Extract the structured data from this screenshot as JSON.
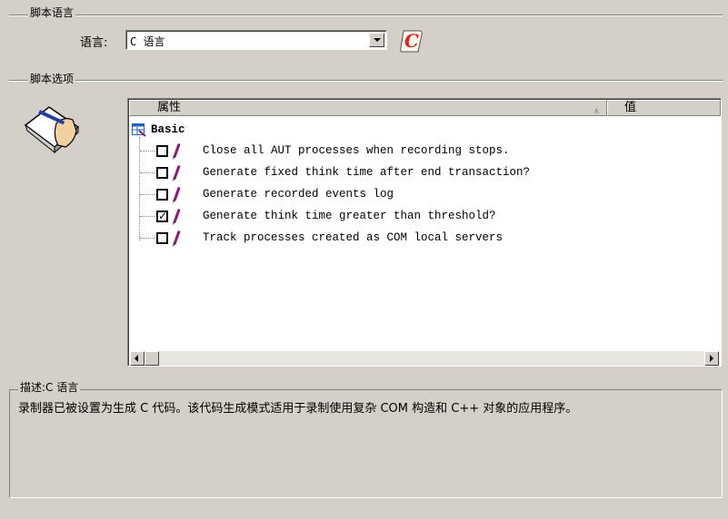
{
  "script_language_group": {
    "title": "脚本语言"
  },
  "language": {
    "label": "语言:",
    "selected": "C 语言"
  },
  "script_options_group": {
    "title": "脚本选项"
  },
  "property_list": {
    "col_property": "属性",
    "col_value": "值",
    "category": "Basic",
    "options": [
      {
        "label": "Close all AUT processes when recording stops.",
        "checked": false
      },
      {
        "label": "Generate fixed think time after end transaction?",
        "checked": false
      },
      {
        "label": "Generate recorded events log",
        "checked": false
      },
      {
        "label": "Generate think time greater than threshold?",
        "checked": true
      },
      {
        "label": "Track processes created as COM local servers",
        "checked": false
      }
    ]
  },
  "description": {
    "title": "描述:C 语言",
    "text": "录制器已被设置为生成 C 代码。该代码生成模式适用于录制使用复杂 COM 构造和 C++ 对象的应用程序。"
  },
  "icons": [
    "language-settings-icon",
    "options-notepad-icon",
    "category-grid-icon",
    "checkbox-icon",
    "pencil-icon"
  ],
  "colors": {
    "background": "#d4d0c8",
    "pencil": "#8b1a7a",
    "accent_red": "#e02020"
  }
}
